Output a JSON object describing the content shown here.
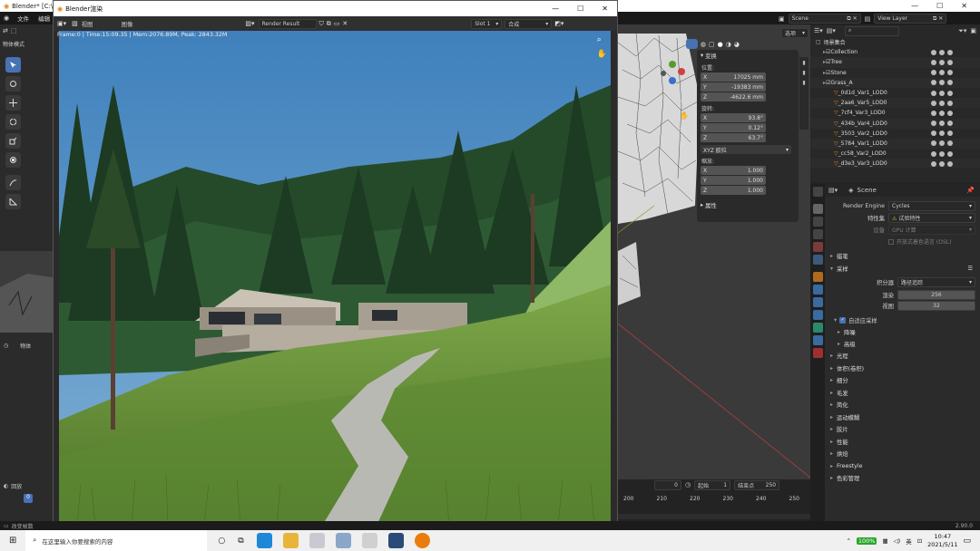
{
  "main_window": {
    "title": "Blender* [C:\\",
    "menu": [
      "文件",
      "编辑"
    ],
    "mode": "物体模式",
    "scene_field": "Scene",
    "view_layer": "View Layer",
    "left_bottom_tabs": [
      "物体"
    ],
    "left_bottom_dropdown": "回放",
    "frame_current_left": "0"
  },
  "render_window": {
    "title": "Blender渲染",
    "menu": [
      "视图",
      "图像"
    ],
    "image_name": "Render Result",
    "slot": "Slot 1",
    "layer": "合成",
    "stats": "Frame:0 | Time:15:09.35 | Mem:2076.89M, Peak: 2843.32M"
  },
  "viewport": {
    "header_dropdown": "选项",
    "n_panel": {
      "tab": "变换",
      "location_label": "位置:",
      "location": [
        {
          "axis": "X",
          "value": "17025 mm"
        },
        {
          "axis": "Y",
          "value": "-19383 mm"
        },
        {
          "axis": "Z",
          "value": "-4622.6 mm"
        }
      ],
      "rotation_label": "旋转:",
      "rotation": [
        {
          "axis": "X",
          "value": "93.8°"
        },
        {
          "axis": "Y",
          "value": "0.12°"
        },
        {
          "axis": "Z",
          "value": "63.7°"
        }
      ],
      "rotation_mode": "XYZ 欧拉",
      "scale_label": "缩放:",
      "scale": [
        {
          "axis": "X",
          "value": "1.000"
        },
        {
          "axis": "Y",
          "value": "1.000"
        },
        {
          "axis": "Z",
          "value": "1.000"
        }
      ],
      "properties_section": "属性"
    }
  },
  "timeline": {
    "current_frame": "0",
    "start_label": "起始",
    "start": "1",
    "end_label": "结束点",
    "end": "250",
    "ticks": [
      "200",
      "210",
      "220",
      "230",
      "240",
      "250"
    ]
  },
  "outliner": {
    "root": "场景集合",
    "items": [
      {
        "name": "Collection",
        "level": 1
      },
      {
        "name": "Tree",
        "level": 1
      },
      {
        "name": "Stone",
        "level": 1
      },
      {
        "name": "Grass_A",
        "level": 1
      },
      {
        "name": "_0d1d_Var1_LOD0",
        "level": 2
      },
      {
        "name": "_2aa6_Var5_LOD0",
        "level": 2
      },
      {
        "name": "_7cf4_Var3_LOD0",
        "level": 2
      },
      {
        "name": "_434b_Var4_LOD0",
        "level": 2
      },
      {
        "name": "_3503_Var2_LOD0",
        "level": 2
      },
      {
        "name": "_5784_Var1_LOD0",
        "level": 2
      },
      {
        "name": "_cc58_Var2_LOD0",
        "level": 2
      },
      {
        "name": "_d3e3_Var3_LOD0",
        "level": 2
      }
    ]
  },
  "properties": {
    "scene": "Scene",
    "render_engine_label": "Render Engine",
    "render_engine": "Cycles",
    "feature_set_label": "特性集",
    "feature_set": "试验特性",
    "device_label": "设备",
    "device": "GPU 计算",
    "osl_label": "开放式着色语言 (OSL)",
    "sections_top": [
      "蜡笔"
    ],
    "sampling_label": "采样",
    "integrator_label": "积分器",
    "integrator": "路径追踪",
    "render_label": "渲染",
    "render_samples": "256",
    "viewport_label": "视图",
    "viewport_samples": "32",
    "adaptive_label": "自适应采样",
    "sub_sections": [
      "降噪",
      "高级"
    ],
    "sections": [
      "光程",
      "体积(卷积)",
      "细分",
      "毛发",
      "简化",
      "运动模糊",
      "胶片",
      "性能",
      "烘焙",
      "Freestyle",
      "色彩管理"
    ]
  },
  "statusbar": {
    "left": "改变帧数",
    "version": "2.90.0"
  },
  "taskbar": {
    "search_placeholder": "在这里输入你要搜索的内容",
    "battery": "100%",
    "ime": "英",
    "time": "10:47",
    "date": "2021/5/11"
  },
  "colors": {
    "accent": "#4772b3",
    "sky": "#4f8ec2",
    "grass": "#6f9a3a",
    "trees": "#1f3d24"
  }
}
